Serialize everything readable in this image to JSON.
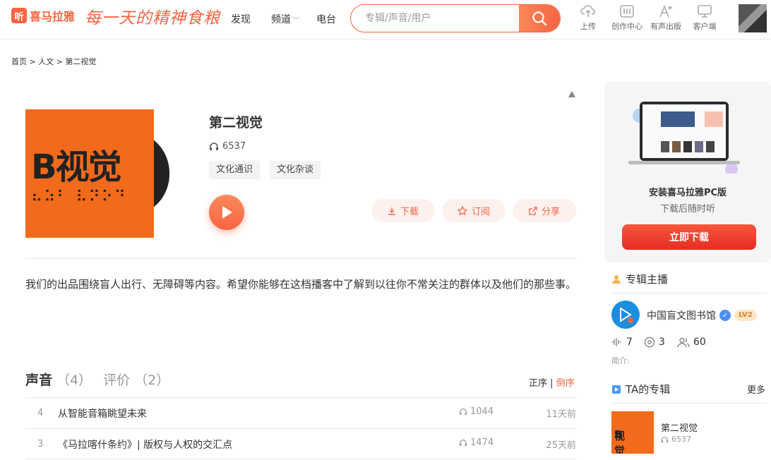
{
  "header": {
    "logo_glyph": "听",
    "logo_text": "喜马拉雅",
    "slogan": "每一天的精神食粮",
    "nav": [
      {
        "label": "发现"
      },
      {
        "label": "频道"
      },
      {
        "label": "电台"
      }
    ],
    "search": {
      "placeholder": "专辑/声音/用户"
    },
    "tools": [
      {
        "label": "上传",
        "icon": "upload-cloud-icon"
      },
      {
        "label": "创作中心",
        "icon": "sliders-icon"
      },
      {
        "label": "有声出版",
        "icon": "text-plus-icon"
      },
      {
        "label": "客户端",
        "icon": "monitor-icon"
      }
    ],
    "brand_color": "#f86442"
  },
  "breadcrumb": [
    "首页",
    "人文",
    "第二视觉"
  ],
  "breadcrumb_sep": ">",
  "album": {
    "cover_text": "视觉",
    "cover_glyph": "B",
    "title": "第二视觉",
    "plays": "6537",
    "tags": [
      "文化通识",
      "文化杂谈"
    ],
    "actions": [
      {
        "label": "下载",
        "icon": "download-icon"
      },
      {
        "label": "订阅",
        "icon": "star-icon"
      },
      {
        "label": "分享",
        "icon": "share-icon"
      }
    ],
    "description": "我们的出品围绕盲人出行、无障碍等内容。希望你能够在这档播客中了解到以往你不常关注的群体以及他们的那些事。"
  },
  "tabs": [
    {
      "label": "声音",
      "count": "（4）",
      "active": true
    },
    {
      "label": "评价",
      "count": "（2）",
      "active": false
    }
  ],
  "sort": {
    "asc": "正序",
    "sep": "|",
    "desc": "倒序",
    "active": "desc"
  },
  "tracks": [
    {
      "index": "4",
      "title": "从智能音箱眺望未来",
      "plays": "1044",
      "time": "11天前"
    },
    {
      "index": "3",
      "title": "《马拉喀什条约》| 版权与人权的交汇点",
      "plays": "1474",
      "time": "25天前"
    }
  ],
  "pc_card": {
    "title": "安装喜马拉雅PC版",
    "subtitle": "下载后随时听",
    "button": "立即下载"
  },
  "anchor_section": {
    "title": "专辑主播"
  },
  "anchor": {
    "name": "中国盲文图书馆",
    "level": "LV2",
    "stats": [
      {
        "icon": "soundwave-icon",
        "value": "7"
      },
      {
        "icon": "album-icon",
        "value": "3"
      },
      {
        "icon": "fans-icon",
        "value": "60"
      }
    ],
    "intro_label": "简介:"
  },
  "albums_section": {
    "title": "TA的专辑",
    "more": "更多"
  },
  "ta_albums": [
    {
      "title": "第二视觉",
      "plays": "6537"
    }
  ]
}
